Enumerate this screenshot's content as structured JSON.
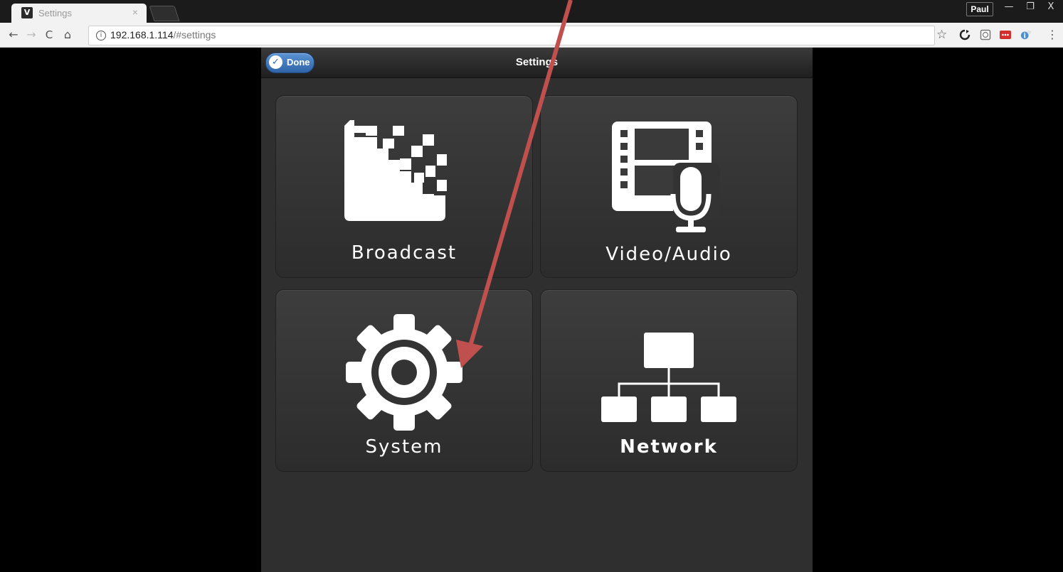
{
  "browser": {
    "tab_title": "Settings",
    "tab_favicon": "V",
    "tab_close_icon": "×",
    "profile_name": "Paul",
    "window_controls": {
      "minimize": "—",
      "restore": "❐",
      "close": "X"
    },
    "nav": {
      "back": "←",
      "forward": "→",
      "reload": "C",
      "home": "⌂"
    },
    "url_host": "192.168.1.114",
    "url_path": "/#settings",
    "star_icon": "☆"
  },
  "app": {
    "header": {
      "done_label": "Done",
      "title": "Settings"
    },
    "tiles": [
      {
        "id": "broadcast",
        "label": "Broadcast",
        "icon": "broadcast-icon"
      },
      {
        "id": "video-audio",
        "label": "Video/Audio",
        "icon": "video-audio-icon"
      },
      {
        "id": "system",
        "label": "System",
        "icon": "gear-icon"
      },
      {
        "id": "network",
        "label": "Network",
        "icon": "network-icon"
      }
    ]
  },
  "colors": {
    "accent_blue": "#3d78c0",
    "annotation_arrow": "#c0504d",
    "panel": "#2f2f2f"
  }
}
